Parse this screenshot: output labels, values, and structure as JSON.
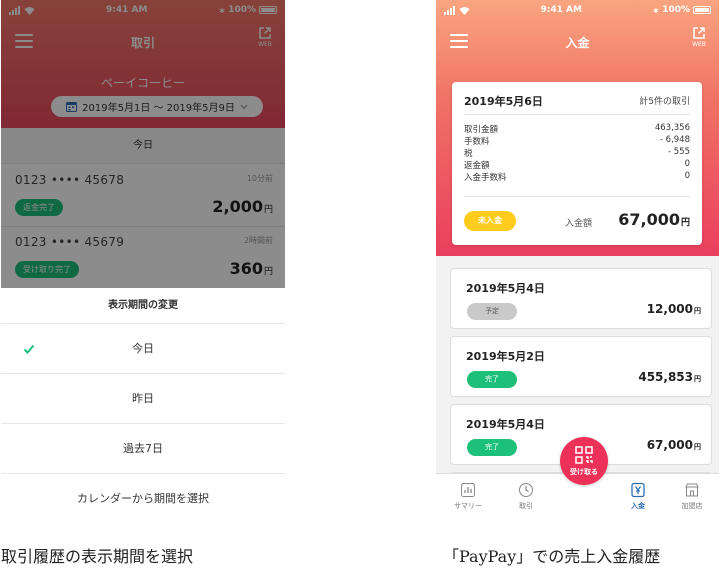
{
  "left": {
    "status": {
      "time": "9:41 AM",
      "battery": "100%"
    },
    "nav": {
      "title": "取引",
      "web": "WEB"
    },
    "store_name": "ペーイコーヒー",
    "date_range": "2019年5月1日 〜 2019年5月9日",
    "today_label": "今日",
    "transactions": [
      {
        "number": "0123 •••• 45678",
        "time": "10分前",
        "status": "返金完了",
        "amount": "2,000",
        "unit": "円"
      },
      {
        "number": "0123 •••• 45679",
        "time": "2時間前",
        "status": "受け取り完了",
        "amount": "360",
        "unit": "円"
      }
    ],
    "sheet": {
      "title": "表示期間の変更",
      "options": [
        "今日",
        "昨日",
        "過去7日",
        "カレンダーから期間を選択"
      ],
      "selected_index": 0
    }
  },
  "right": {
    "status": {
      "time": "9:41 AM",
      "battery": "100%"
    },
    "nav": {
      "title": "入金",
      "web": "WEB"
    },
    "summary": {
      "date": "2019年5月6日",
      "count": "計5件の取引",
      "rows": [
        {
          "label": "取引金額",
          "value": "463,356"
        },
        {
          "label": "手数料",
          "value": "- 6,948"
        },
        {
          "label": "税",
          "value": "- 555"
        },
        {
          "label": "返金額",
          "value": "0"
        },
        {
          "label": "入金手数料",
          "value": "0"
        }
      ],
      "status": "未入金",
      "deposit_label": "入金額",
      "deposit_amount": "67,000",
      "unit": "円"
    },
    "deposits": [
      {
        "date": "2019年5月4日",
        "status": "予定",
        "amount": "12,000",
        "unit": "円",
        "color": "#c9c9c9"
      },
      {
        "date": "2019年5月2日",
        "status": "完了",
        "amount": "455,853",
        "unit": "円",
        "color": "#1dc07a"
      },
      {
        "date": "2019年5月4日",
        "status": "完了",
        "amount": "67,000",
        "unit": "円",
        "color": "#1dc07a"
      }
    ],
    "tabs": [
      "サマリー",
      "取引",
      "受け取る",
      "入金",
      "加盟店"
    ],
    "active_tab": "入金"
  },
  "captions": {
    "left": "取引履歴の表示期間を選択",
    "right": "「PayPay」での売上入金履歴"
  }
}
